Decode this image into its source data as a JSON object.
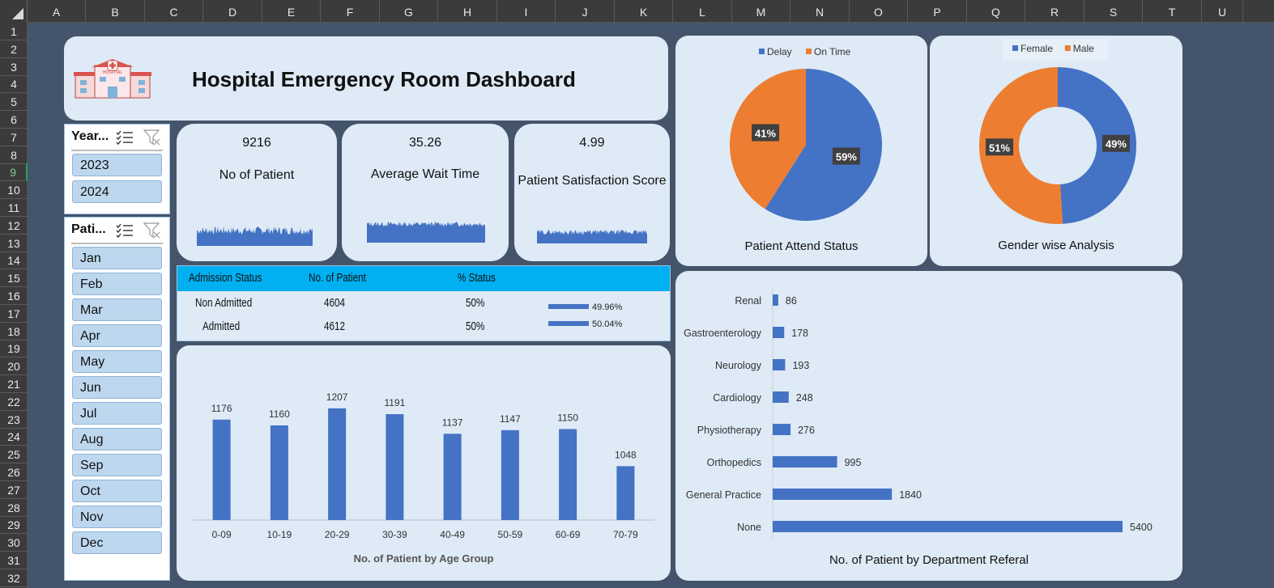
{
  "columns": [
    "A",
    "B",
    "C",
    "D",
    "E",
    "F",
    "G",
    "H",
    "I",
    "J",
    "K",
    "L",
    "M",
    "N",
    "O",
    "P",
    "Q",
    "R",
    "S",
    "T",
    "U"
  ],
  "rows": [
    "1",
    "2",
    "3",
    "4",
    "5",
    "6",
    "7",
    "8",
    "9",
    "10",
    "11",
    "12",
    "13",
    "14",
    "15",
    "16",
    "17",
    "18",
    "19",
    "20",
    "21",
    "22",
    "23",
    "24",
    "25",
    "26",
    "27",
    "28",
    "29",
    "30",
    "31",
    "32"
  ],
  "dashboard": {
    "title": "Hospital Emergency Room Dashboard",
    "logo_text": "HOSPITAL"
  },
  "slicers": {
    "year": {
      "header": "Year...",
      "items": [
        "2023",
        "2024"
      ]
    },
    "month": {
      "header": "Pati...",
      "items": [
        "Jan",
        "Feb",
        "Mar",
        "Apr",
        "May",
        "Jun",
        "Jul",
        "Aug",
        "Sep",
        "Oct",
        "Nov",
        "Dec"
      ]
    }
  },
  "kpis": [
    {
      "value": "9216",
      "label": "No of Patient"
    },
    {
      "value": "35.26",
      "label": "Average Wait Time"
    },
    {
      "value": "4.99",
      "label": "Patient Satisfaction Score"
    }
  ],
  "admission_table": {
    "headers": [
      "Admission Status",
      "No. of Patient",
      "% Status"
    ],
    "rows": [
      {
        "status": "Non Admitted",
        "count": "4604",
        "pct": "50%",
        "bar_label": "49.96%",
        "bar_fraction": 0.4996
      },
      {
        "status": "Admitted",
        "count": "4612",
        "pct": "50%",
        "bar_label": "50.04%",
        "bar_fraction": 0.5004
      }
    ]
  },
  "colors": {
    "blue": "#4472c4",
    "orange": "#ed7d31",
    "panel": "#deeaf6",
    "header_cyan": "#00b0f0",
    "background": "#44546a"
  },
  "chart_data": [
    {
      "type": "pie",
      "title": "Patient Attend Status",
      "legend": [
        "Delay",
        "On Time"
      ],
      "legend_position": "top",
      "slices": [
        {
          "name": "Delay",
          "value": 59,
          "label": "59%"
        },
        {
          "name": "On Time",
          "value": 41,
          "label": "41%"
        }
      ]
    },
    {
      "type": "donut",
      "title": "Gender wise Analysis",
      "legend": [
        "Female",
        "Male"
      ],
      "legend_position": "top",
      "slices": [
        {
          "name": "Female",
          "value": 49,
          "label": "49%"
        },
        {
          "name": "Male",
          "value": 51,
          "label": "51%"
        }
      ]
    },
    {
      "type": "bar",
      "title": "No. of Patient by Age Group",
      "categories": [
        "0-09",
        "10-19",
        "20-29",
        "30-39",
        "40-49",
        "50-59",
        "60-69",
        "70-79"
      ],
      "values": [
        1176,
        1160,
        1207,
        1191,
        1137,
        1147,
        1150,
        1048
      ],
      "ylim": [
        900,
        1220
      ],
      "grid": false
    },
    {
      "type": "hbar",
      "title": "No. of Patient by Department Referal",
      "categories": [
        "Renal",
        "Gastroenterology",
        "Neurology",
        "Cardiology",
        "Physiotherapy",
        "Orthopedics",
        "General Practice",
        "None"
      ],
      "values": [
        86,
        178,
        193,
        248,
        276,
        995,
        1840,
        5400
      ],
      "xlim": [
        0,
        5400
      ],
      "grid": false
    }
  ]
}
